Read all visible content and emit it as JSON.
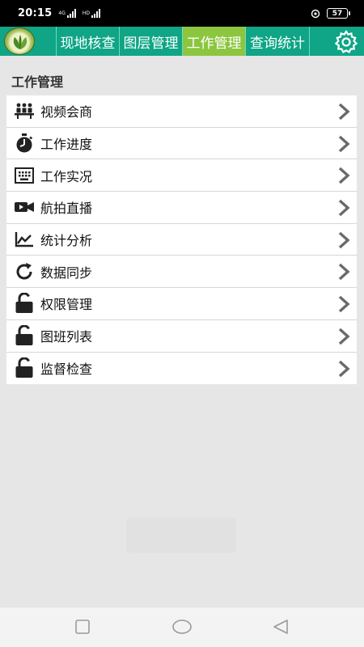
{
  "status_bar": {
    "time": "20:15",
    "signal_tag_1": "4G",
    "signal_tag_2": "HD",
    "battery": "57"
  },
  "app_bar": {
    "tabs": [
      {
        "label": "现地核查"
      },
      {
        "label": "图层管理"
      },
      {
        "label": "工作管理",
        "active": true
      },
      {
        "label": "查询统计"
      }
    ],
    "accent_color": "#0fa586",
    "active_tab_color": "#8cc63f"
  },
  "section": {
    "title": "工作管理"
  },
  "menu": {
    "items": [
      {
        "label": "视频会商",
        "icon": "video-conference-icon"
      },
      {
        "label": "工作进度",
        "icon": "stopwatch-icon"
      },
      {
        "label": "工作实况",
        "icon": "keyboard-icon"
      },
      {
        "label": "航拍直播",
        "icon": "video-camera-icon"
      },
      {
        "label": "统计分析",
        "icon": "line-chart-icon"
      },
      {
        "label": "数据同步",
        "icon": "refresh-icon"
      },
      {
        "label": "权限管理",
        "icon": "unlock-icon"
      },
      {
        "label": "图班列表",
        "icon": "unlock-icon"
      },
      {
        "label": "监督检查",
        "icon": "unlock-icon"
      }
    ]
  }
}
